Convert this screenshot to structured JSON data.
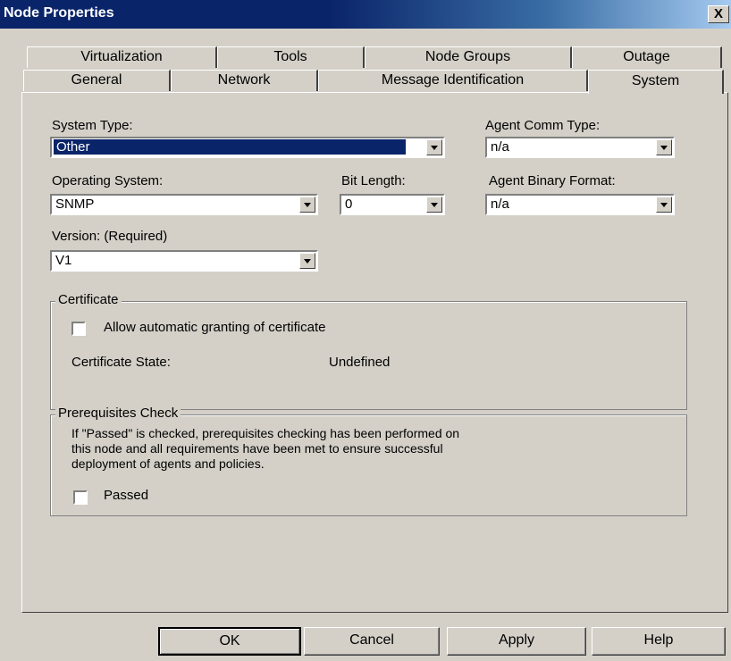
{
  "window": {
    "title": "Node Properties",
    "close_glyph": "X"
  },
  "tabs": {
    "row1": [
      "Virtualization",
      "Tools",
      "Node Groups",
      "Outage"
    ],
    "row2": [
      "General",
      "Network",
      "Message Identification",
      "System"
    ],
    "selected": "System"
  },
  "system": {
    "system_type": {
      "label": "System Type:",
      "value": "Other"
    },
    "agent_comm_type": {
      "label": "Agent Comm Type:",
      "value": "n/a"
    },
    "operating_system": {
      "label": "Operating System:",
      "value": "SNMP"
    },
    "bit_length": {
      "label": "Bit Length:",
      "value": "0"
    },
    "agent_binary_format": {
      "label": "Agent Binary Format:",
      "value": "n/a"
    },
    "version": {
      "label": "Version: (Required)",
      "value": "V1"
    }
  },
  "certificate": {
    "legend": "Certificate",
    "allow_label": "Allow automatic granting of certificate",
    "allow_checked": false,
    "state_label": "Certificate State:",
    "state_value": "Undefined"
  },
  "prerequisites": {
    "legend": "Prerequisites Check",
    "desc_line1": "If \"Passed\" is checked, prerequisites checking has been performed on",
    "desc_line2": "this node and all requirements have been met to ensure successful",
    "desc_line3": "deployment of agents and policies.",
    "passed_label": "Passed",
    "passed_checked": false
  },
  "buttons": {
    "ok": "OK",
    "cancel": "Cancel",
    "apply": "Apply",
    "help": "Help"
  },
  "colors": {
    "title_bar": "#0a246a",
    "face": "#d4d0c8",
    "selection": "#0a246a"
  }
}
